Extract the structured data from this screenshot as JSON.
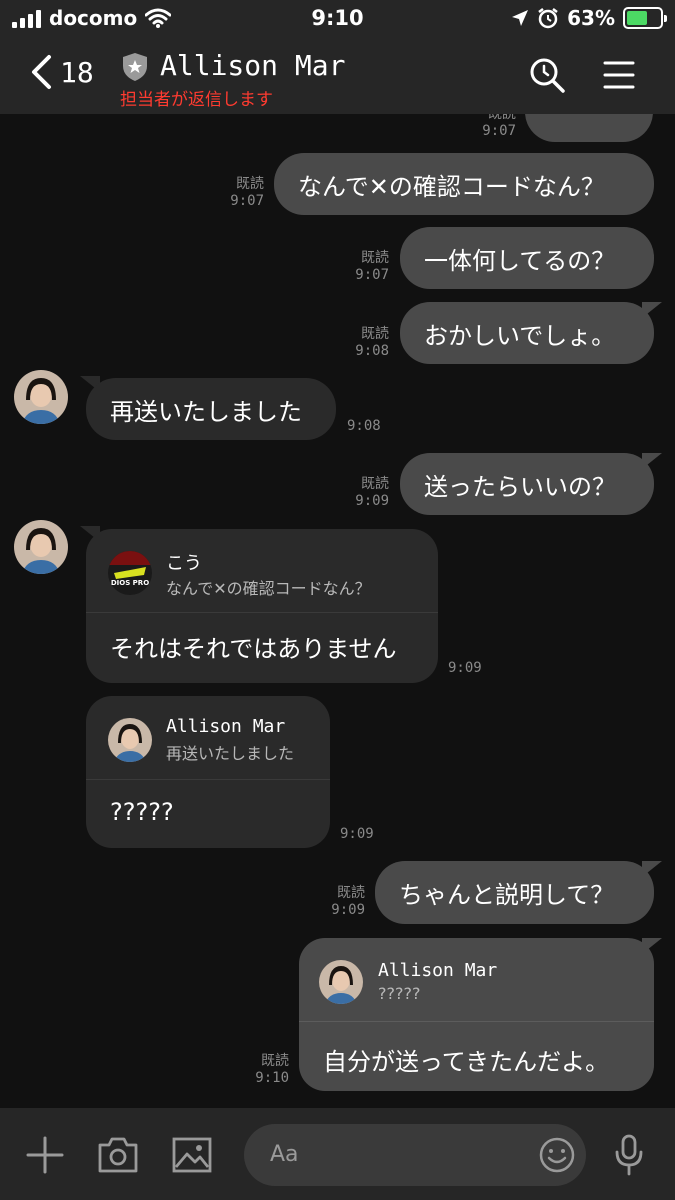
{
  "status_bar": {
    "carrier": "docomo",
    "time": "9:10",
    "battery": "63%",
    "battery_level": 0.63
  },
  "header": {
    "back_count": "18",
    "contact_name": "Allison Mar",
    "subtitle": "担当者が返信します"
  },
  "messages": {
    "m1": {
      "text": "なんで✕の確認コードなん？",
      "read": "既読",
      "time": "9:07"
    },
    "m2": {
      "text": "一体何してるの？",
      "read": "既読",
      "time": "9:07"
    },
    "m3": {
      "text": "おかしいでしょ。",
      "read": "既読",
      "time": "9:08"
    },
    "m4": {
      "text": "再送いたしました",
      "time": "9:08"
    },
    "m5": {
      "text": "送ったらいいの？",
      "read": "既読",
      "time": "9:09"
    },
    "m6": {
      "quote_name": "こう",
      "quote_text": "なんで✕の確認コードなん？",
      "text": "それはそれではありません",
      "time": "9:09"
    },
    "m7": {
      "quote_name": "Allison Mar",
      "quote_text": "再送いたしました",
      "text": "?????",
      "time": "9:09"
    },
    "m8": {
      "text": "ちゃんと説明して？",
      "read": "既読",
      "time": "9:09"
    },
    "m9": {
      "quote_name": "Allison Mar",
      "quote_text": "?????",
      "text": "自分が送ってきたんだよ。",
      "read": "既読",
      "time": "9:10"
    },
    "top_partial": {
      "read": "既読",
      "time": "9:07"
    }
  },
  "input": {
    "placeholder": "Aa"
  },
  "colors": {
    "outgoing_bubble": "#4a4a4a",
    "incoming_bubble": "#2a2a2a",
    "background": "#111111",
    "bar": "#262626",
    "subtitle": "#ff3b30",
    "battery": "#4cd964"
  }
}
